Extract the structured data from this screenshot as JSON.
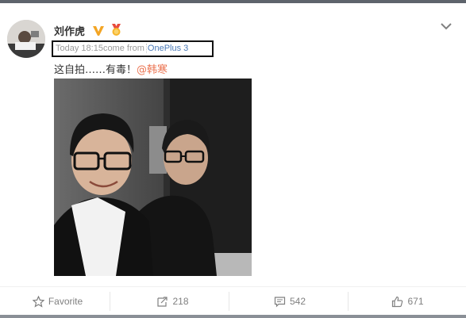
{
  "post": {
    "username": "刘作虎",
    "timestamp": "Today 18:15",
    "source_prefix": "come from",
    "device": "OnePlus 3",
    "text": "这自拍……有毒！",
    "mention": "@韩寒"
  },
  "actions": {
    "favorite_label": "Favorite",
    "repost_count": "218",
    "comment_count": "542",
    "like_count": "671"
  },
  "icons": [
    "verified-v-icon",
    "medal-icon",
    "chevron-down-icon",
    "star-icon",
    "repost-icon",
    "comment-icon",
    "thumbs-up-icon"
  ],
  "colors": {
    "mention": "#eb7350",
    "device_link": "#4a79b6",
    "verified": "#f3a524"
  }
}
